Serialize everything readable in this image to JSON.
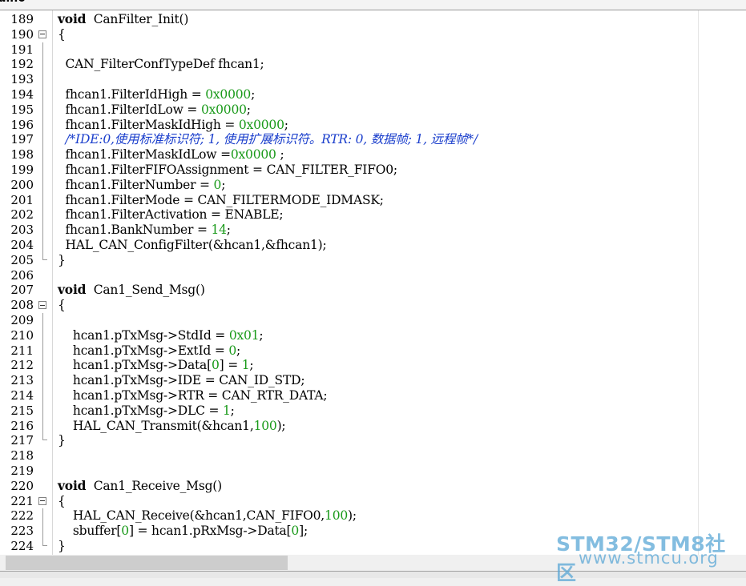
{
  "tab": {
    "label": "ain0"
  },
  "lines": [
    {
      "n": "189",
      "fold": "",
      "segs": [
        [
          "kw",
          "void"
        ],
        [
          "",
          "  CanFilter_Init()"
        ]
      ]
    },
    {
      "n": "190",
      "fold": "open",
      "segs": [
        [
          "",
          "{"
        ]
      ]
    },
    {
      "n": "191",
      "fold": "bar",
      "segs": []
    },
    {
      "n": "192",
      "fold": "bar",
      "segs": [
        [
          "",
          "  CAN_FilterConfTypeDef fhcan1;"
        ]
      ]
    },
    {
      "n": "193",
      "fold": "bar",
      "segs": []
    },
    {
      "n": "194",
      "fold": "bar",
      "segs": [
        [
          "",
          "  fhcan1.FilterIdHigh = "
        ],
        [
          "num",
          "0x0000"
        ],
        [
          "",
          ";"
        ]
      ]
    },
    {
      "n": "195",
      "fold": "bar",
      "segs": [
        [
          "",
          "  fhcan1.FilterIdLow = "
        ],
        [
          "num",
          "0x0000"
        ],
        [
          "",
          ";"
        ]
      ]
    },
    {
      "n": "196",
      "fold": "bar",
      "segs": [
        [
          "",
          "  fhcan1.FilterMaskIdHigh = "
        ],
        [
          "num",
          "0x0000"
        ],
        [
          "",
          ";"
        ]
      ]
    },
    {
      "n": "197",
      "fold": "bar",
      "segs": [
        [
          "",
          "  "
        ],
        [
          "cmt",
          "/*IDE:0,使用标准标识符; 1, 使用扩展标识符。RTR: 0, 数据帧; 1, 远程帧*/"
        ]
      ]
    },
    {
      "n": "198",
      "fold": "bar",
      "segs": [
        [
          "",
          "  fhcan1.FilterMaskIdLow ="
        ],
        [
          "num",
          "0x0000"
        ],
        [
          "",
          " ;"
        ]
      ]
    },
    {
      "n": "199",
      "fold": "bar",
      "segs": [
        [
          "",
          "  fhcan1.FilterFIFOAssignment = CAN_FILTER_FIFO0;"
        ]
      ]
    },
    {
      "n": "200",
      "fold": "bar",
      "segs": [
        [
          "",
          "  fhcan1.FilterNumber = "
        ],
        [
          "num",
          "0"
        ],
        [
          "",
          ";"
        ]
      ]
    },
    {
      "n": "201",
      "fold": "bar",
      "segs": [
        [
          "",
          "  fhcan1.FilterMode = CAN_FILTERMODE_IDMASK;"
        ]
      ]
    },
    {
      "n": "202",
      "fold": "bar",
      "segs": [
        [
          "",
          "  fhcan1.FilterActivation = ENABLE;"
        ]
      ]
    },
    {
      "n": "203",
      "fold": "bar",
      "segs": [
        [
          "",
          "  fhcan1.BankNumber = "
        ],
        [
          "num",
          "14"
        ],
        [
          "",
          ";"
        ]
      ]
    },
    {
      "n": "204",
      "fold": "bar",
      "segs": [
        [
          "",
          "  HAL_CAN_ConfigFilter(&hcan1,&fhcan1);"
        ]
      ]
    },
    {
      "n": "205",
      "fold": "end",
      "segs": [
        [
          "",
          "}"
        ]
      ]
    },
    {
      "n": "206",
      "fold": "",
      "segs": []
    },
    {
      "n": "207",
      "fold": "",
      "segs": [
        [
          "kw",
          "void"
        ],
        [
          "",
          "  Can1_Send_Msg()"
        ]
      ]
    },
    {
      "n": "208",
      "fold": "open",
      "segs": [
        [
          "",
          "{"
        ]
      ]
    },
    {
      "n": "209",
      "fold": "bar",
      "segs": []
    },
    {
      "n": "210",
      "fold": "bar",
      "segs": [
        [
          "",
          "    hcan1.pTxMsg->StdId = "
        ],
        [
          "num",
          "0x01"
        ],
        [
          "",
          ";"
        ]
      ]
    },
    {
      "n": "211",
      "fold": "bar",
      "segs": [
        [
          "",
          "    hcan1.pTxMsg->ExtId = "
        ],
        [
          "num",
          "0"
        ],
        [
          "",
          ";"
        ]
      ]
    },
    {
      "n": "212",
      "fold": "bar",
      "segs": [
        [
          "",
          "    hcan1.pTxMsg->Data["
        ],
        [
          "num",
          "0"
        ],
        [
          "",
          "] = "
        ],
        [
          "num",
          "1"
        ],
        [
          "",
          ";"
        ]
      ]
    },
    {
      "n": "213",
      "fold": "bar",
      "segs": [
        [
          "",
          "    hcan1.pTxMsg->IDE = CAN_ID_STD;"
        ]
      ]
    },
    {
      "n": "214",
      "fold": "bar",
      "segs": [
        [
          "",
          "    hcan1.pTxMsg->RTR = CAN_RTR_DATA;"
        ]
      ]
    },
    {
      "n": "215",
      "fold": "bar",
      "segs": [
        [
          "",
          "    hcan1.pTxMsg->DLC = "
        ],
        [
          "num",
          "1"
        ],
        [
          "",
          ";"
        ]
      ]
    },
    {
      "n": "216",
      "fold": "bar",
      "segs": [
        [
          "",
          "    HAL_CAN_Transmit(&hcan1,"
        ],
        [
          "num",
          "100"
        ],
        [
          "",
          ");"
        ]
      ]
    },
    {
      "n": "217",
      "fold": "end",
      "segs": [
        [
          "",
          "}"
        ]
      ]
    },
    {
      "n": "218",
      "fold": "",
      "segs": []
    },
    {
      "n": "219",
      "fold": "",
      "segs": []
    },
    {
      "n": "220",
      "fold": "",
      "segs": [
        [
          "kw",
          "void"
        ],
        [
          "",
          "  Can1_Receive_Msg()"
        ]
      ]
    },
    {
      "n": "221",
      "fold": "open",
      "segs": [
        [
          "",
          "{"
        ]
      ]
    },
    {
      "n": "222",
      "fold": "bar",
      "segs": [
        [
          "",
          "    HAL_CAN_Receive(&hcan1,CAN_FIFO0,"
        ],
        [
          "num",
          "100"
        ],
        [
          "",
          ");"
        ]
      ]
    },
    {
      "n": "223",
      "fold": "bar",
      "segs": [
        [
          "",
          "    sbuffer["
        ],
        [
          "num",
          "0"
        ],
        [
          "",
          "] = hcan1.pRxMsg->Data["
        ],
        [
          "num",
          "0"
        ],
        [
          "",
          "];"
        ]
      ]
    },
    {
      "n": "224",
      "fold": "end",
      "segs": [
        [
          "",
          "}"
        ]
      ]
    }
  ],
  "watermark": {
    "line1": "STM32/STM8社区",
    "line2": "www.stmcu.org"
  }
}
